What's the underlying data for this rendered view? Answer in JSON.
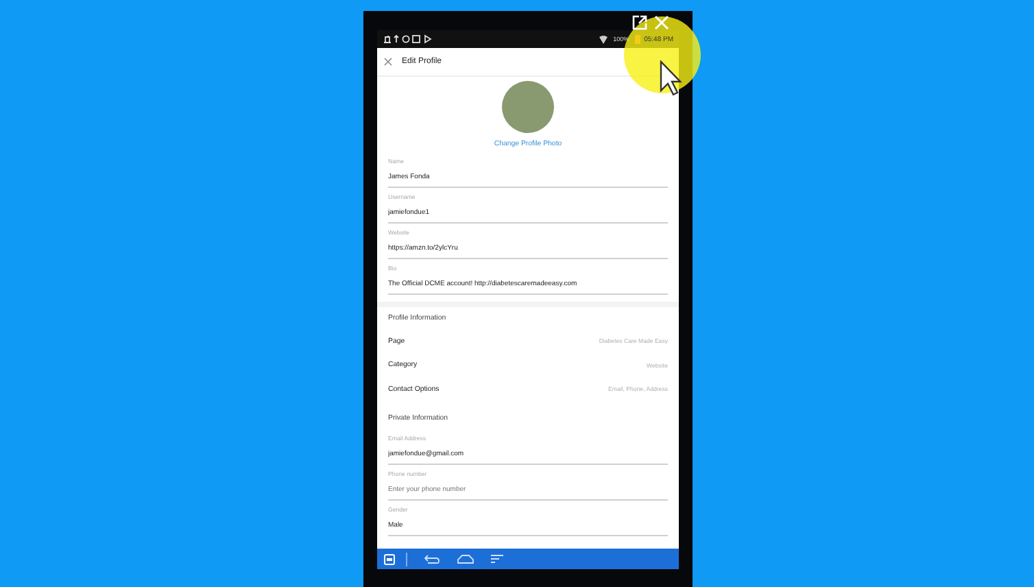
{
  "status_bar": {
    "battery": "100%",
    "time": "05:48 PM"
  },
  "app_bar": {
    "title": "Edit Profile"
  },
  "profile": {
    "change_photo_link": "Change Profile Photo"
  },
  "fields": [
    {
      "label": "Name",
      "value": "James Fonda"
    },
    {
      "label": "Username",
      "value": "jamiefondue1"
    },
    {
      "label": "Website",
      "value": "https://amzn.to/2ylcYru"
    },
    {
      "label": "Bio",
      "value": "The Official DCME account! http://diabetescaremadeeasy.com"
    }
  ],
  "profile_information": {
    "heading": "Profile Information",
    "rows": [
      {
        "label": "Page",
        "value": "Diabetes Care Made Easy"
      },
      {
        "label": "Category",
        "value": "Website"
      },
      {
        "label": "Contact Options",
        "value": "Email, Phone, Address"
      }
    ]
  },
  "private_information": {
    "heading": "Private Information",
    "fields": [
      {
        "label": "Email Address",
        "value": "jamiefondue@gmail.com"
      },
      {
        "label": "Phone number",
        "placeholder": "Enter your phone number"
      },
      {
        "label": "Gender",
        "value": "Male"
      }
    ]
  }
}
